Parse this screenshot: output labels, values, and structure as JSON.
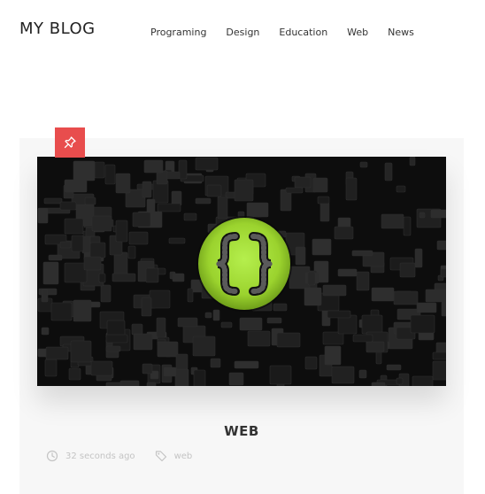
{
  "site": {
    "title": "MY BLOG"
  },
  "nav": {
    "items": [
      "Programing",
      "Design",
      "Education",
      "Web",
      "News"
    ]
  },
  "post": {
    "title": "WEB",
    "badge_icon": "pin-icon",
    "image_icon": "curly-braces-icon",
    "time_ago": "32 seconds ago",
    "tag": "web"
  },
  "colors": {
    "badge": "#e84d4d",
    "logo_green": "#9bd32e",
    "card_bg": "#f7f7f7",
    "image_bg": "#0d0d0d"
  }
}
